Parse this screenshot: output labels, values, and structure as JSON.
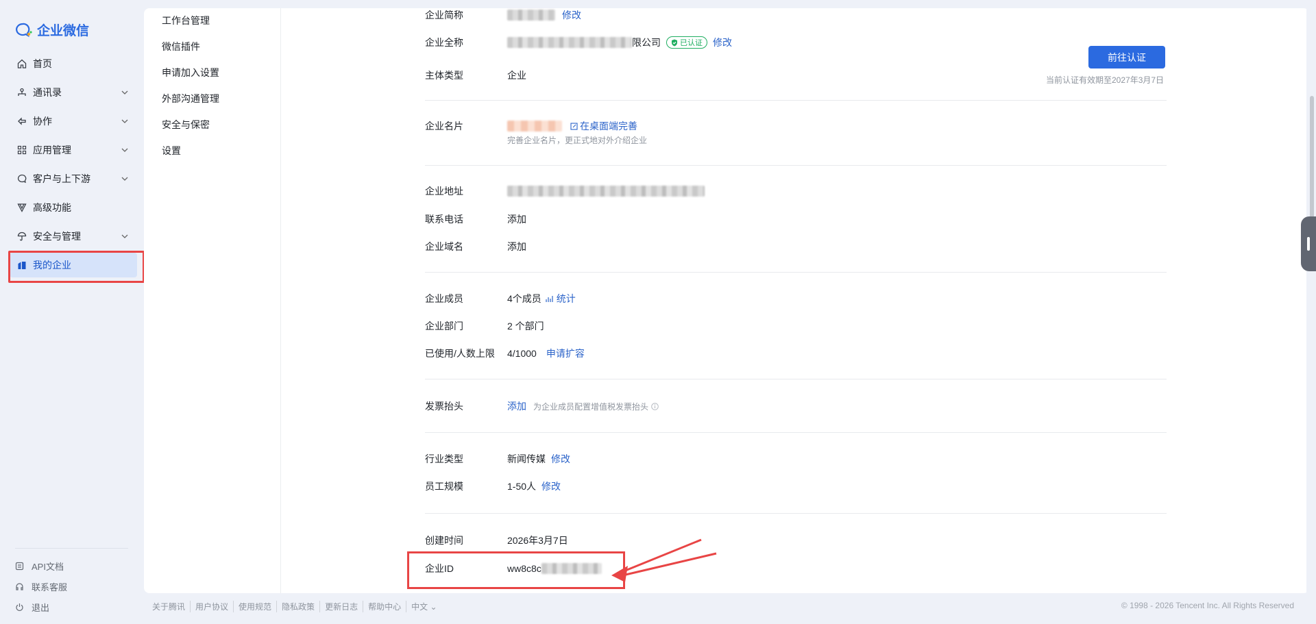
{
  "app": {
    "logo_text": "企业微信",
    "brand_color": "#2b6ae0"
  },
  "sidebar": {
    "items": [
      {
        "label": "首页",
        "icon": "home-icon",
        "has_children": false
      },
      {
        "label": "通讯录",
        "icon": "org-icon",
        "has_children": true
      },
      {
        "label": "协作",
        "icon": "collab-icon",
        "has_children": true
      },
      {
        "label": "应用管理",
        "icon": "apps-icon",
        "has_children": true
      },
      {
        "label": "客户与上下游",
        "icon": "chat-icon",
        "has_children": true
      },
      {
        "label": "高级功能",
        "icon": "advanced-icon",
        "has_children": false
      },
      {
        "label": "安全与管理",
        "icon": "umbrella-icon",
        "has_children": true
      },
      {
        "label": "我的企业",
        "icon": "building-icon",
        "has_children": false,
        "active": true
      }
    ],
    "bottom": [
      {
        "label": "API文档",
        "icon": "api-doc-icon"
      },
      {
        "label": "联系客服",
        "icon": "headset-icon"
      },
      {
        "label": "退出",
        "icon": "power-icon"
      }
    ]
  },
  "subnav": {
    "items": [
      "工作台管理",
      "微信插件",
      "申请加入设置",
      "外部沟通管理",
      "安全与保密",
      "设置"
    ]
  },
  "company": {
    "short_name": {
      "label": "企业简称",
      "action": "修改"
    },
    "full_name": {
      "label": "企业全称",
      "visible_suffix": "限公司",
      "badge": "已认证",
      "action": "修改"
    },
    "subject_type": {
      "label": "主体类型",
      "value": "企业"
    },
    "certify_button": "前往认证",
    "certify_note": "当前认证有效期至2027年3月7日",
    "card": {
      "label": "企业名片",
      "link": "在桌面端完善",
      "hint": "完善企业名片，更正式地对外介绍企业"
    },
    "address": {
      "label": "企业地址"
    },
    "phone": {
      "label": "联系电话",
      "action": "添加"
    },
    "domain": {
      "label": "企业域名",
      "action": "添加"
    },
    "members": {
      "label": "企业成员",
      "value": "4个成员",
      "action": "统计"
    },
    "departments": {
      "label": "企业部门",
      "value": "2 个部门"
    },
    "capacity": {
      "label": "已使用/人数上限",
      "value": "4/1000",
      "action": "申请扩容"
    },
    "invoice": {
      "label": "发票抬头",
      "action": "添加",
      "hint": "为企业成员配置增值税发票抬头"
    },
    "industry": {
      "label": "行业类型",
      "value": "新闻传媒",
      "action": "修改"
    },
    "scale": {
      "label": "员工规模",
      "value": "1-50人",
      "action": "修改"
    },
    "created": {
      "label": "创建时间",
      "value": "2026年3月7日"
    },
    "corp_id": {
      "label": "企业ID",
      "visible_prefix": "ww8c8c"
    }
  },
  "footer": {
    "links": [
      "关于腾讯",
      "用户协议",
      "使用规范",
      "隐私政策",
      "更新日志",
      "帮助中心",
      "中文"
    ],
    "copyright": "© 1998 - 2026 Tencent Inc. All Rights Reserved"
  },
  "colors": {
    "highlight_red": "#e84545",
    "link_blue": "#2b63c9",
    "verified_green": "#1fae60"
  }
}
